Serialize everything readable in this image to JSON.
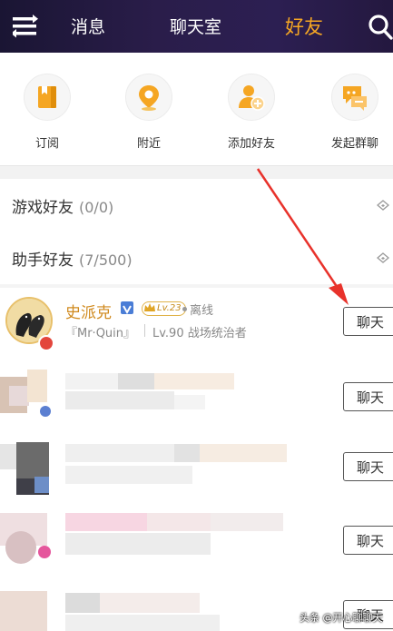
{
  "header": {
    "tabs": [
      {
        "label": "消息",
        "active": false
      },
      {
        "label": "聊天室",
        "active": false
      },
      {
        "label": "好友",
        "active": true
      }
    ],
    "accent_color": "#f5a623"
  },
  "quick_actions": [
    {
      "label": "订阅",
      "icon": "bookmark-icon"
    },
    {
      "label": "附近",
      "icon": "location-pin-icon"
    },
    {
      "label": "添加好友",
      "icon": "add-friend-icon"
    },
    {
      "label": "发起群聊",
      "icon": "group-chat-icon"
    }
  ],
  "groups": [
    {
      "name": "游戏好友",
      "count": "(0/0)"
    },
    {
      "name": "助手好友",
      "count": "(7/500)"
    }
  ],
  "friends": [
    {
      "name": "史派克",
      "level_badge": "Lv.23",
      "status": "离线",
      "nickname": "『Mr·Quin』",
      "detail": "Lv.90 战场统治者",
      "chat_label": "聊天"
    },
    {
      "chat_label": "聊天"
    },
    {
      "chat_label": "聊天"
    },
    {
      "chat_label": "聊天"
    },
    {
      "chat_label": "聊天"
    }
  ],
  "watermark": "头条 @开心聊聊天"
}
